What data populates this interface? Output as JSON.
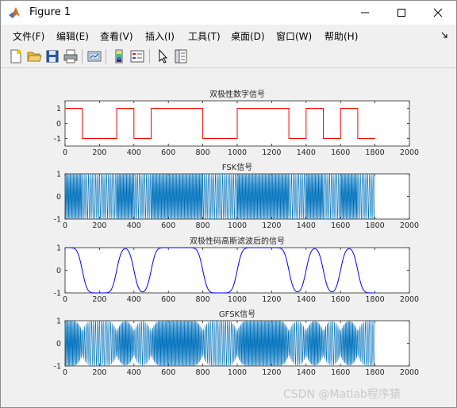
{
  "window": {
    "title": "Figure 1"
  },
  "menu": [
    "文件(F)",
    "编辑(E)",
    "查看(V)",
    "插入(I)",
    "工具(T)",
    "桌面(D)",
    "窗口(W)",
    "帮助(H)"
  ],
  "toolbar": {
    "icons": [
      "new-figure-icon",
      "open-file-icon",
      "save-icon",
      "print-icon",
      "link-plot-icon",
      "colorbar-icon",
      "legend-icon",
      "pointer-icon",
      "property-editor-icon"
    ]
  },
  "chart_data": [
    {
      "type": "line",
      "title": "双极性数字信号",
      "xlim": [
        0,
        2000
      ],
      "ylim": [
        -1.5,
        1.5
      ],
      "xticks": [
        "0",
        "200",
        "400",
        "600",
        "800",
        "1000",
        "1200",
        "1400",
        "1600",
        "1800",
        "2000"
      ],
      "yticks": [
        "1",
        "0",
        "-1"
      ],
      "color": "#ff0000",
      "bits": [
        1,
        -1,
        -1,
        1,
        -1,
        1,
        1,
        1,
        -1,
        -1,
        1,
        1,
        1,
        -1,
        1,
        -1,
        1,
        -1
      ],
      "bit_length": 100,
      "x_end": 1800
    },
    {
      "type": "line",
      "title": "FSK信号",
      "xlim": [
        0,
        2000
      ],
      "ylim": [
        -1,
        1
      ],
      "xticks": [
        "0",
        "200",
        "400",
        "600",
        "800",
        "1000",
        "1200",
        "1400",
        "1600",
        "1800",
        "2000"
      ],
      "yticks": [
        "1",
        "0",
        "-1"
      ],
      "color": "#0072bd",
      "x_end": 1800
    },
    {
      "type": "line",
      "title": "双极性码高斯滤波后的信号",
      "xlim": [
        0,
        2000
      ],
      "ylim": [
        -1,
        1
      ],
      "xticks": [
        "0",
        "200",
        "400",
        "600",
        "800",
        "1000",
        "1200",
        "1400",
        "1600",
        "1800",
        "2000"
      ],
      "yticks": [
        "1",
        "0",
        "-1"
      ],
      "color": "#0000ff",
      "x_end": 1800
    },
    {
      "type": "line",
      "title": "GFSK信号",
      "xlim": [
        0,
        2000
      ],
      "ylim": [
        -1,
        1
      ],
      "xticks": [
        "0",
        "200",
        "400",
        "600",
        "800",
        "1000",
        "1200",
        "1400",
        "1600",
        "1800",
        "2000"
      ],
      "yticks": [
        "1",
        "0",
        "-1"
      ],
      "color": "#0072bd",
      "x_end": 1800
    }
  ],
  "watermark": "CSDN @Matlab程序猿"
}
